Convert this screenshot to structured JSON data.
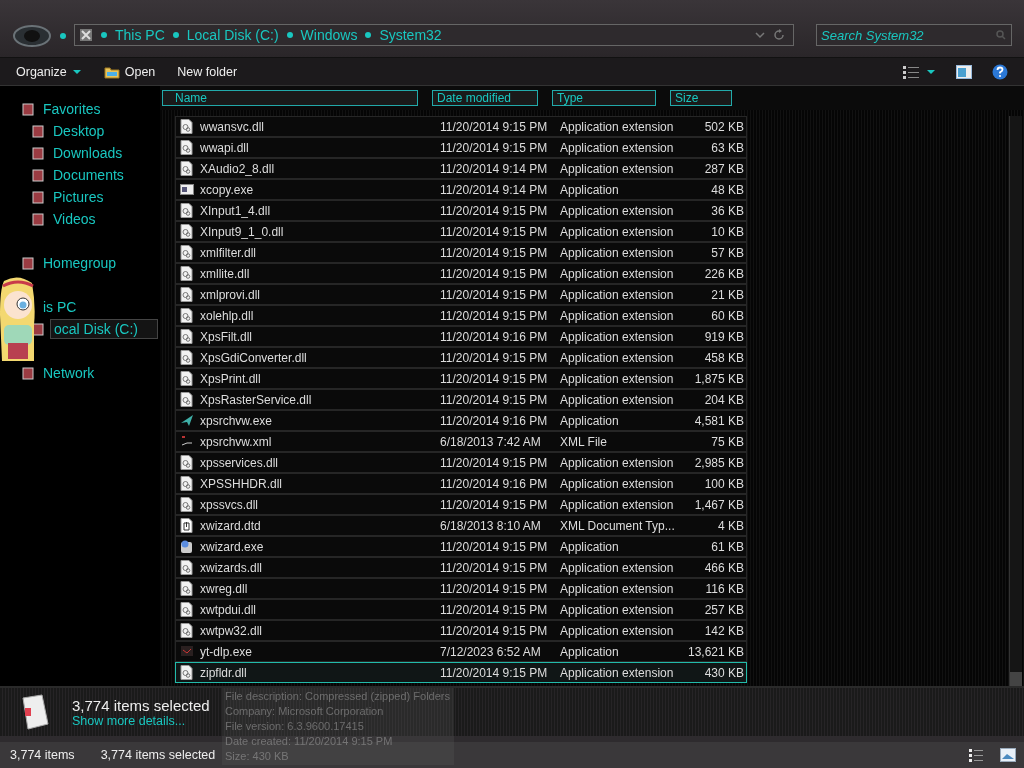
{
  "address_bar": {
    "crumbs": [
      "This PC",
      "Local Disk (C:)",
      "Windows",
      "System32"
    ]
  },
  "search": {
    "placeholder": "Search System32"
  },
  "toolbar": {
    "buttons": [
      {
        "label": "Organize",
        "kind": "menu"
      },
      {
        "label": "Open",
        "kind": "icon"
      },
      {
        "label": "New folder",
        "kind": "plain"
      }
    ]
  },
  "sidebar": {
    "items": [
      {
        "label": "Favorites",
        "selected": false,
        "children": [
          {
            "label": "Desktop",
            "selected": false
          },
          {
            "label": "Downloads",
            "selected": false
          },
          {
            "label": "Documents",
            "selected": false
          },
          {
            "label": "Pictures",
            "selected": false
          },
          {
            "label": "Videos",
            "selected": false
          }
        ]
      },
      {
        "label": "Homegroup",
        "selected": false
      },
      {
        "label": "is PC",
        "selected": false,
        "children": [
          {
            "label": "ocal Disk (C:)",
            "selected": true
          }
        ]
      },
      {
        "label": "Network",
        "selected": false
      }
    ]
  },
  "table": {
    "columns": [
      "Name",
      "Date modified",
      "Type",
      "Size"
    ],
    "rows": [
      {
        "name": "wwansvc.dll",
        "date": "11/20/2014 9:15 PM",
        "type": "Application extension",
        "size": "502 KB",
        "kind": "dll",
        "focused": false
      },
      {
        "name": "wwapi.dll",
        "date": "11/20/2014 9:15 PM",
        "type": "Application extension",
        "size": "63 KB",
        "kind": "dll",
        "focused": false
      },
      {
        "name": "XAudio2_8.dll",
        "date": "11/20/2014 9:14 PM",
        "type": "Application extension",
        "size": "287 KB",
        "kind": "dll",
        "focused": false
      },
      {
        "name": "xcopy.exe",
        "date": "11/20/2014 9:14 PM",
        "type": "Application",
        "size": "48 KB",
        "kind": "window",
        "focused": false
      },
      {
        "name": "XInput1_4.dll",
        "date": "11/20/2014 9:15 PM",
        "type": "Application extension",
        "size": "36 KB",
        "kind": "dll",
        "focused": false
      },
      {
        "name": "XInput9_1_0.dll",
        "date": "11/20/2014 9:15 PM",
        "type": "Application extension",
        "size": "10 KB",
        "kind": "dll",
        "focused": false
      },
      {
        "name": "xmlfilter.dll",
        "date": "11/20/2014 9:15 PM",
        "type": "Application extension",
        "size": "57 KB",
        "kind": "dll",
        "focused": false
      },
      {
        "name": "xmllite.dll",
        "date": "11/20/2014 9:15 PM",
        "type": "Application extension",
        "size": "226 KB",
        "kind": "dll",
        "focused": false
      },
      {
        "name": "xmlprovi.dll",
        "date": "11/20/2014 9:15 PM",
        "type": "Application extension",
        "size": "21 KB",
        "kind": "dll",
        "focused": false
      },
      {
        "name": "xolehlp.dll",
        "date": "11/20/2014 9:15 PM",
        "type": "Application extension",
        "size": "60 KB",
        "kind": "dll",
        "focused": false
      },
      {
        "name": "XpsFilt.dll",
        "date": "11/20/2014 9:16 PM",
        "type": "Application extension",
        "size": "919 KB",
        "kind": "dll",
        "focused": false
      },
      {
        "name": "XpsGdiConverter.dll",
        "date": "11/20/2014 9:15 PM",
        "type": "Application extension",
        "size": "458 KB",
        "kind": "dll",
        "focused": false
      },
      {
        "name": "XpsPrint.dll",
        "date": "11/20/2014 9:15 PM",
        "type": "Application extension",
        "size": "1,875 KB",
        "kind": "dll",
        "focused": false
      },
      {
        "name": "XpsRasterService.dll",
        "date": "11/20/2014 9:15 PM",
        "type": "Application extension",
        "size": "204 KB",
        "kind": "dll",
        "focused": false
      },
      {
        "name": "xpsrchvw.exe",
        "date": "11/20/2014 9:16 PM",
        "type": "Application",
        "size": "4,581 KB",
        "kind": "arrow",
        "focused": false
      },
      {
        "name": "xpsrchvw.xml",
        "date": "6/18/2013 7:42 AM",
        "type": "XML File",
        "size": "75 KB",
        "kind": "xml",
        "focused": false
      },
      {
        "name": "xpsservices.dll",
        "date": "11/20/2014 9:15 PM",
        "type": "Application extension",
        "size": "2,985 KB",
        "kind": "dll",
        "focused": false
      },
      {
        "name": "XPSSHHDR.dll",
        "date": "11/20/2014 9:16 PM",
        "type": "Application extension",
        "size": "100 KB",
        "kind": "dll",
        "focused": false
      },
      {
        "name": "xpssvcs.dll",
        "date": "11/20/2014 9:15 PM",
        "type": "Application extension",
        "size": "1,467 KB",
        "kind": "dll",
        "focused": false
      },
      {
        "name": "xwizard.dtd",
        "date": "6/18/2013 8:10 AM",
        "type": "XML Document Typ...",
        "size": "4 KB",
        "kind": "dtd",
        "focused": false
      },
      {
        "name": "xwizard.exe",
        "date": "11/20/2014 9:15 PM",
        "type": "Application",
        "size": "61 KB",
        "kind": "wizard",
        "focused": false
      },
      {
        "name": "xwizards.dll",
        "date": "11/20/2014 9:15 PM",
        "type": "Application extension",
        "size": "466 KB",
        "kind": "dll",
        "focused": false
      },
      {
        "name": "xwreg.dll",
        "date": "11/20/2014 9:15 PM",
        "type": "Application extension",
        "size": "116 KB",
        "kind": "dll",
        "focused": false
      },
      {
        "name": "xwtpdui.dll",
        "date": "11/20/2014 9:15 PM",
        "type": "Application extension",
        "size": "257 KB",
        "kind": "dll",
        "focused": false
      },
      {
        "name": "xwtpw32.dll",
        "date": "11/20/2014 9:15 PM",
        "type": "Application extension",
        "size": "142 KB",
        "kind": "dll",
        "focused": false
      },
      {
        "name": "yt-dlp.exe",
        "date": "7/12/2023 6:52 AM",
        "type": "Application",
        "size": "13,621 KB",
        "kind": "dark",
        "focused": false
      },
      {
        "name": "zipfldr.dll",
        "date": "11/20/2014 9:15 PM",
        "type": "Application extension",
        "size": "430 KB",
        "kind": "dll",
        "focused": true
      }
    ]
  },
  "details_pane": {
    "title": "3,774 items selected",
    "link": "Show more details..."
  },
  "tooltip": {
    "lines": [
      "File description: Compressed (zipped) Folders",
      "Company: Microsoft Corporation",
      "File version: 6.3.9600.17415",
      "Date created: 11/20/2014 9:15 PM",
      "Size: 430 KB"
    ]
  },
  "status_bar": {
    "count": "3,774 items",
    "selection": "3,774 items selected"
  }
}
